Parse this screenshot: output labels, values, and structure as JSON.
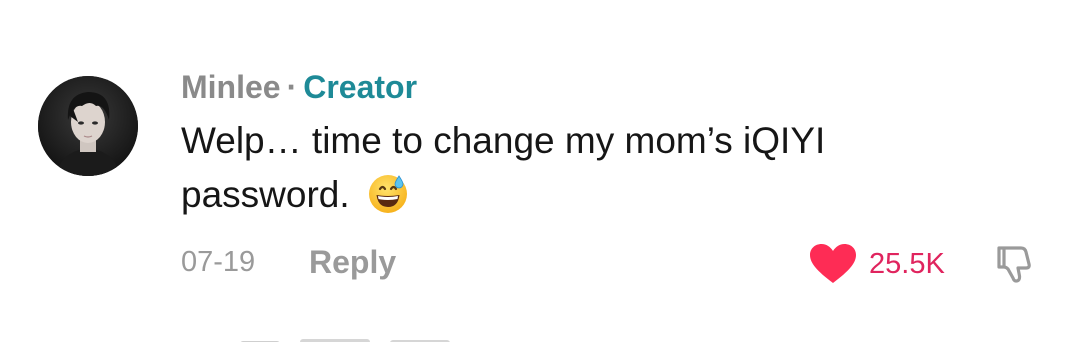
{
  "comment": {
    "author": "Minlee",
    "separator": "·",
    "author_badge": "Creator",
    "text": "Welp… time to change my mom’s iQIYI password.",
    "emoji": "grinning-face-with-sweat",
    "date": "07-19",
    "reply_label": "Reply",
    "likes": "25.5K",
    "liked": true
  },
  "colors": {
    "creator_badge": "#1e8a97",
    "like_heart": "#fe2c55",
    "muted_text": "#8a8a8a"
  },
  "icons": {
    "like": "heart-icon",
    "dislike": "thumbs-down-icon"
  }
}
